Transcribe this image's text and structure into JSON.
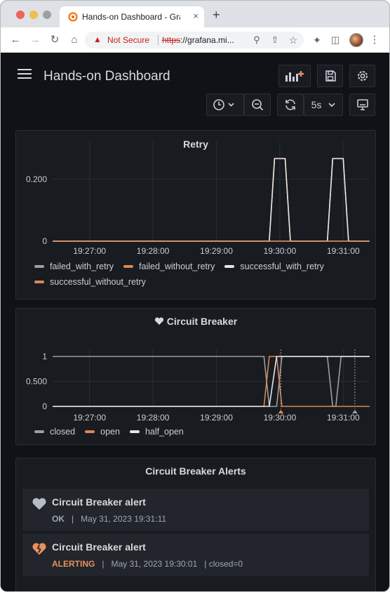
{
  "browser": {
    "tab_title": "Hands-on Dashboard - Grafana",
    "tab_close": "×",
    "new_tab": "+",
    "not_secure": "Not Secure",
    "url_scheme": "https",
    "url_rest": "://grafana.mi...",
    "toolbar_icons": [
      "back-icon",
      "forward-icon",
      "reload-icon",
      "home-icon",
      "zoom-icon",
      "share-icon",
      "bookmark-icon",
      "extensions-icon",
      "side-panel-icon",
      "profile-avatar",
      "menu-icon"
    ]
  },
  "dashboard": {
    "title": "Hands-on Dashboard",
    "refresh_interval": "5s",
    "toolbar_icons": [
      "add-panel-icon",
      "save-icon",
      "settings-icon",
      "clock-icon",
      "zoom-out-icon",
      "refresh-icon",
      "tv-mode-icon"
    ]
  },
  "colors": {
    "background": "#111217",
    "panel": "#181b1f",
    "series_gray": "#9a9ea8",
    "series_orange": "#d9875b",
    "series_white": "#e6e6e6",
    "alert_ok": "#b7bcc4",
    "alert_alerting": "#e8915e"
  },
  "panels": {
    "retry": {
      "title": "Retry"
    },
    "circuit_breaker": {
      "title": "Circuit Breaker"
    },
    "alerts": {
      "title": "Circuit Breaker Alerts",
      "items": [
        {
          "title": "Circuit Breaker alert",
          "state": "OK",
          "sep": "|",
          "time": "May 31, 2023 19:31:11",
          "extra": "",
          "icon": "heart-icon",
          "state_color": "#9fa7b3"
        },
        {
          "title": "Circuit Breaker alert",
          "state": "ALERTING",
          "sep": "|",
          "time": "May 31, 2023 19:30:01",
          "extra": "|  closed=0",
          "icon": "broken-heart-icon",
          "state_color": "#e8915e"
        }
      ]
    }
  },
  "chart_data": [
    {
      "type": "line",
      "title": "Retry",
      "x_ticks": [
        "19:27:00",
        "19:28:00",
        "19:29:00",
        "19:30:00",
        "19:31:00"
      ],
      "y_ticks": [
        "0",
        "0.200"
      ],
      "ylim": [
        0,
        0.3
      ],
      "x": [
        "19:26:25",
        "19:27:00",
        "19:28:00",
        "19:29:00",
        "19:29:50",
        "19:29:55",
        "19:30:05",
        "19:30:10",
        "19:30:45",
        "19:30:50",
        "19:31:00",
        "19:31:05",
        "19:31:25"
      ],
      "series": [
        {
          "name": "failed_with_retry",
          "color": "#9a9ea8",
          "values": [
            0,
            0,
            0,
            0,
            0,
            0,
            0,
            0,
            0,
            0,
            0,
            0,
            0
          ]
        },
        {
          "name": "failed_without_retry",
          "color": "#d9875b",
          "values": [
            0,
            0,
            0,
            0,
            0,
            0.267,
            0.267,
            0,
            0,
            0.267,
            0.267,
            0,
            0
          ]
        },
        {
          "name": "successful_with_retry",
          "color": "#e6e6e6",
          "values": [
            0,
            0,
            0,
            0,
            0,
            0.267,
            0.267,
            0,
            0,
            0.267,
            0.267,
            0,
            0
          ]
        },
        {
          "name": "successful_without_retry",
          "color": "#d9875b",
          "values": [
            0,
            0,
            0,
            0,
            0,
            0,
            0,
            0,
            0,
            0,
            0,
            0,
            0
          ]
        }
      ],
      "grid": true,
      "legend": "bottom"
    },
    {
      "type": "line",
      "title": "Circuit Breaker",
      "x_ticks": [
        "19:27:00",
        "19:28:00",
        "19:29:00",
        "19:30:00",
        "19:31:00"
      ],
      "y_ticks": [
        "0",
        "0.500",
        "1"
      ],
      "ylim": [
        0,
        1
      ],
      "x": [
        "19:26:25",
        "19:27:00",
        "19:28:00",
        "19:29:00",
        "19:29:45",
        "19:29:50",
        "19:29:57",
        "19:30:02",
        "19:30:45",
        "19:30:50",
        "19:30:53",
        "19:30:58",
        "19:31:25"
      ],
      "series": [
        {
          "name": "closed",
          "color": "#9a9ea8",
          "values": [
            1,
            1,
            1,
            1,
            1,
            0,
            0,
            1,
            1,
            0,
            0,
            1,
            1
          ]
        },
        {
          "name": "open",
          "color": "#d9875b",
          "values": [
            0,
            0,
            0,
            0,
            0,
            1,
            1,
            0,
            0,
            0,
            0,
            0,
            0
          ]
        },
        {
          "name": "half_open",
          "color": "#e6e6e6",
          "values": [
            0,
            0,
            0,
            0,
            0,
            0,
            1,
            1,
            1,
            1,
            1,
            1,
            1
          ]
        }
      ],
      "annotations": [
        "19:30:01",
        "19:31:11"
      ],
      "grid": true,
      "legend": "bottom"
    }
  ]
}
